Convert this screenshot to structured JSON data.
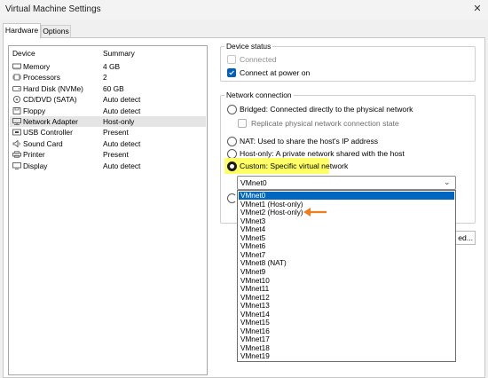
{
  "window": {
    "title": "Virtual Machine Settings",
    "close_glyph": "✕"
  },
  "tabs": [
    {
      "label": "Hardware"
    },
    {
      "label": "Options"
    }
  ],
  "device_table": {
    "headers": {
      "device": "Device",
      "summary": "Summary"
    },
    "rows": [
      {
        "name": "Memory",
        "summary": "4 GB",
        "icon": "memory-icon"
      },
      {
        "name": "Processors",
        "summary": "2",
        "icon": "processor-icon"
      },
      {
        "name": "Hard Disk (NVMe)",
        "summary": "60 GB",
        "icon": "hard-disk-icon"
      },
      {
        "name": "CD/DVD (SATA)",
        "summary": "Auto detect",
        "icon": "cd-dvd-icon"
      },
      {
        "name": "Floppy",
        "summary": "Auto detect",
        "icon": "floppy-icon"
      },
      {
        "name": "Network Adapter",
        "summary": "Host-only",
        "icon": "network-adapter-icon",
        "selected": true
      },
      {
        "name": "USB Controller",
        "summary": "Present",
        "icon": "usb-icon"
      },
      {
        "name": "Sound Card",
        "summary": "Auto detect",
        "icon": "sound-card-icon"
      },
      {
        "name": "Printer",
        "summary": "Present",
        "icon": "printer-icon"
      },
      {
        "name": "Display",
        "summary": "Auto detect",
        "icon": "display-icon"
      }
    ]
  },
  "device_status": {
    "title": "Device status",
    "connected": {
      "label": "Connected",
      "checked": false,
      "disabled": true
    },
    "connect_at_power_on": {
      "label": "Connect at power on",
      "checked": true
    }
  },
  "network_connection": {
    "title": "Network connection",
    "bridged": "Bridged: Connected directly to the physical network",
    "replicate": "Replicate physical network connection state",
    "nat": "NAT: Used to share the host's IP address",
    "host_only": "Host-only: A private network shared with the host",
    "custom": "Custom: Specific virtual network",
    "selected": "custom"
  },
  "vmnet_select": {
    "value": "VMnet0",
    "chevron": "⌄",
    "options": [
      "VMnet0",
      "VMnet1 (Host-only)",
      "VMnet2 (Host-only)",
      "VMnet3",
      "VMnet4",
      "VMnet5",
      "VMnet6",
      "VMnet7",
      "VMnet8 (NAT)",
      "VMnet9",
      "VMnet10",
      "VMnet11",
      "VMnet12",
      "VMnet13",
      "VMnet14",
      "VMnet15",
      "VMnet16",
      "VMnet17",
      "VMnet18",
      "VMnet19"
    ],
    "highlighted_index": 0
  },
  "partial_button": {
    "label": "ed..."
  },
  "colors": {
    "accent": "#0067c0",
    "highlight": "#ffff66",
    "arrow": "#f07c1e"
  }
}
